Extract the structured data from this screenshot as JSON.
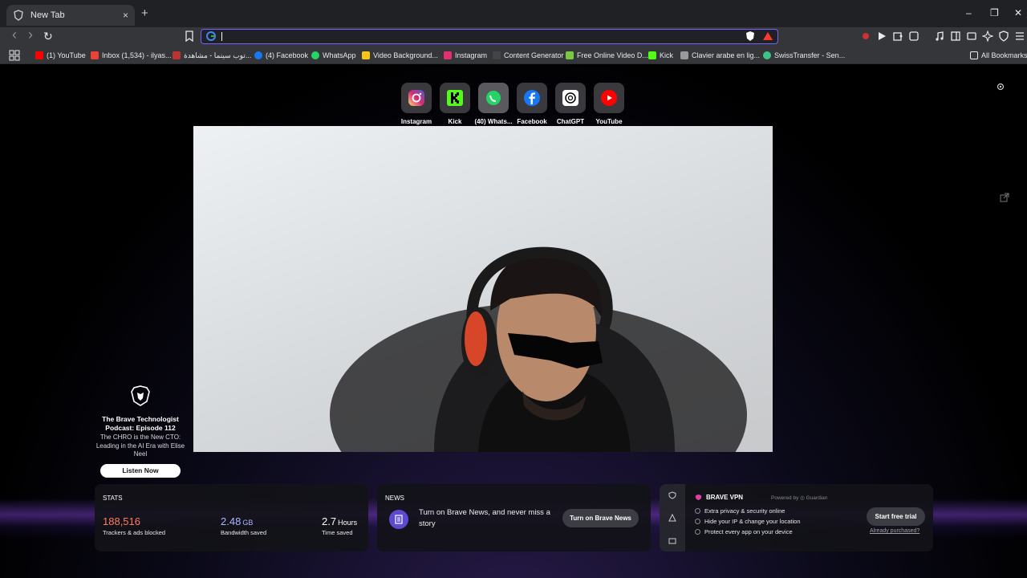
{
  "tab": {
    "title": "New Tab",
    "close": "×",
    "new": "+"
  },
  "window_controls": {
    "minimize": "–",
    "restore": "❐",
    "close": "✕"
  },
  "nav": {
    "back": "‹",
    "forward": "›",
    "reload": "↻"
  },
  "omnibox": {
    "value": "",
    "placeholder": ""
  },
  "bookmarks": [
    {
      "label": "(1) YouTube",
      "color": "#ff0000"
    },
    {
      "label": "Inbox (1,534) - ilyas...",
      "color": "#ea4335"
    },
    {
      "label": "توب سينما - مشاهدة...",
      "color": "#b33"
    },
    {
      "label": "(4) Facebook",
      "color": "#1877f2"
    },
    {
      "label": "WhatsApp",
      "color": "#25d366"
    },
    {
      "label": "Video Background...",
      "color": "#f5c518"
    },
    {
      "label": "Instagram",
      "color": "#e1306c"
    },
    {
      "label": "Content Generator",
      "color": "#444"
    },
    {
      "label": "Free Online Video D...",
      "color": "#7ac943"
    },
    {
      "label": "Kick",
      "color": "#53fc18"
    },
    {
      "label": "Clavier arabe en lig...",
      "color": "#999"
    },
    {
      "label": "SwissTransfer - Sen...",
      "color": "#3ec486"
    }
  ],
  "all_bookmarks": "All Bookmarks",
  "top_sites": [
    {
      "label": "Instagram",
      "icon": "instagram-icon"
    },
    {
      "label": "Kick",
      "icon": "kick-icon"
    },
    {
      "label": "(40) Whats...",
      "icon": "whatsapp-icon"
    },
    {
      "label": "Facebook",
      "icon": "facebook-icon"
    },
    {
      "label": "ChatGPT",
      "icon": "chatgpt-icon"
    },
    {
      "label": "YouTube",
      "icon": "youtube-icon"
    }
  ],
  "promo": {
    "title": "The Brave Technologist Podcast: Episode 112",
    "description": "The CHRO is the New CTO: Leading in the AI Era with Elise Neel",
    "button": "Listen Now"
  },
  "stats": {
    "header": "STATS",
    "trackers_value": "188,516",
    "trackers_label": "Trackers & ads blocked",
    "bandwidth_value": "2.48",
    "bandwidth_unit": "GB",
    "bandwidth_label": "Bandwidth saved",
    "time_value": "2.7",
    "time_unit": "Hours",
    "time_label": "Time saved"
  },
  "news": {
    "header": "NEWS",
    "text": "Turn on Brave News, and never miss a story",
    "button": "Turn on Brave News"
  },
  "vpn": {
    "title": "BRAVE VPN",
    "powered": "Powered by",
    "partner": "Guardian",
    "features": [
      "Extra privacy & security online",
      "Hide your IP & change your location",
      "Protect every app on your device"
    ],
    "button": "Start free trial",
    "already": "Already purchased?"
  },
  "colors": {
    "accent": "#7b5cff",
    "trackers": "#ff7b5c",
    "bandwidth": "#a9b8ff"
  }
}
